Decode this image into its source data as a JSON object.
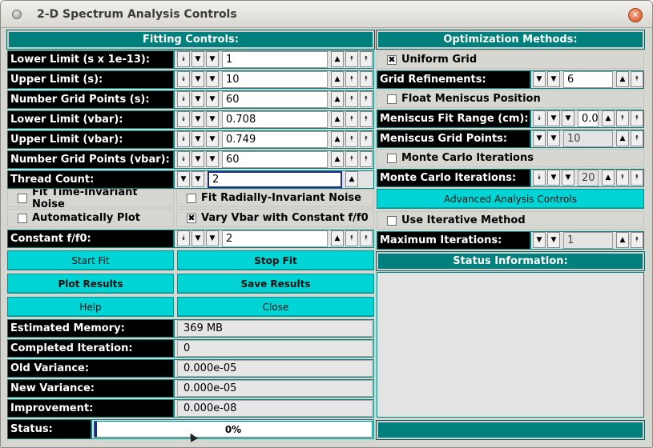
{
  "window": {
    "title": "2-D Spectrum Analysis Controls"
  },
  "left_header": "Fitting Controls:",
  "right_header": "Optimization Methods:",
  "fitting_rows": [
    {
      "label": "Lower Limit (s x 1e-13):",
      "value": "1"
    },
    {
      "label": "Upper Limit (s):",
      "value": "10"
    },
    {
      "label": "Number Grid Points (s):",
      "value": "60"
    },
    {
      "label": "Lower Limit (vbar):",
      "value": "0.708"
    },
    {
      "label": "Upper Limit (vbar):",
      "value": "0.749"
    },
    {
      "label": "Number Grid Points (vbar):",
      "value": "60"
    },
    {
      "label": "Thread Count:",
      "value": "2"
    }
  ],
  "checks": {
    "fit_ti_noise": {
      "label": "Fit Time-Invariant Noise",
      "checked": false
    },
    "fit_ri_noise": {
      "label": "Fit Radially-Invariant Noise",
      "checked": false
    },
    "auto_plot": {
      "label": "Automatically Plot",
      "checked": false
    },
    "vary_vbar": {
      "label": "Vary Vbar with Constant f/f0",
      "checked": true
    }
  },
  "constant_ff0": {
    "label": "Constant f/f0:",
    "value": "2"
  },
  "buttons": {
    "start_fit": "Start Fit",
    "stop_fit": "Stop Fit",
    "plot_results": "Plot Results",
    "save_results": "Save Results",
    "help": "Help",
    "close": "Close",
    "advanced": "Advanced Analysis Controls"
  },
  "info_rows": [
    {
      "label": "Estimated Memory:",
      "value": "369 MB"
    },
    {
      "label": "Completed Iteration:",
      "value": "0"
    },
    {
      "label": "Old Variance:",
      "value": "0.000e-05"
    },
    {
      "label": "New Variance:",
      "value": "0.000e-05"
    },
    {
      "label": "Improvement:",
      "value": "0.000e-08"
    }
  ],
  "status": {
    "label": "Status:",
    "progress_text": "0%",
    "progress_fraction": 0.0
  },
  "optimization": {
    "uniform_grid": {
      "label": "Uniform Grid",
      "checked": true
    },
    "grid_refinements": {
      "label": "Grid Refinements:",
      "value": "6"
    },
    "float_meniscus": {
      "label": "Float Meniscus Position",
      "checked": false
    },
    "meniscus_range": {
      "label": "Meniscus Fit Range (cm):",
      "value": "0.0"
    },
    "meniscus_points": {
      "label": "Meniscus Grid Points:",
      "value": "10"
    },
    "monte_carlo": {
      "label": "Monte Carlo Iterations",
      "checked": false
    },
    "monte_carlo_iters": {
      "label": "Monte Carlo Iterations:",
      "value": "20"
    },
    "iterative": {
      "label": "Use Iterative Method",
      "checked": false
    },
    "max_iters": {
      "label": "Maximum Iterations:",
      "value": "1"
    }
  },
  "status_header": "Status Information:",
  "icons": {
    "double_down": "⯯",
    "down": "▼",
    "up": "▲",
    "double_up": "⯭",
    "check": "✖"
  }
}
